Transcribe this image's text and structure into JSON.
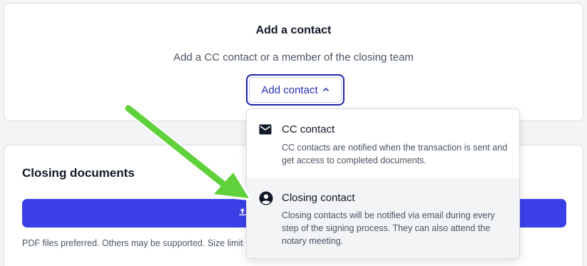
{
  "contact_card": {
    "title": "Add a contact",
    "subtitle": "Add a CC contact or a member of the closing team",
    "add_button_label": "Add contact"
  },
  "docs_card": {
    "title": "Closing documents",
    "note": "PDF files preferred. Others may be supported. Size limit"
  },
  "dropdown": {
    "items": [
      {
        "icon": "envelope-icon",
        "title": "CC contact",
        "description": "CC contacts are notified when the transaction is sent and get access to completed documents."
      },
      {
        "icon": "user-circle-icon",
        "title": "Closing contact",
        "description": "Closing contacts will be notified via email during every step of the signing process. They can also attend the notary meeting."
      }
    ]
  },
  "colors": {
    "primary": "#3b3fe6",
    "button_border": "#1e23a8",
    "annotation_arrow": "#5fd13a"
  }
}
